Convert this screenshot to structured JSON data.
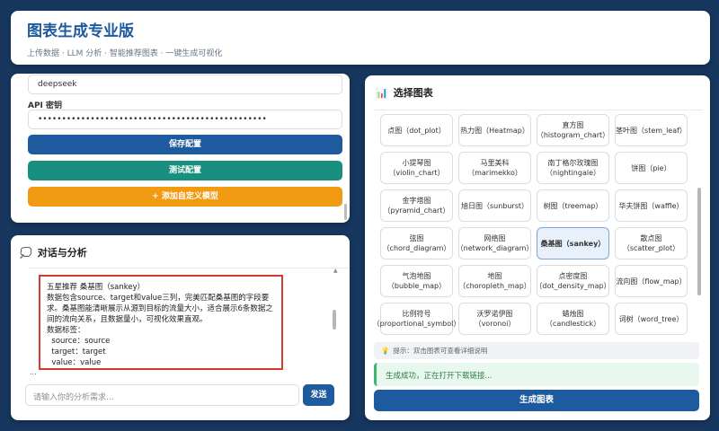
{
  "header": {
    "title": "图表生成专业版",
    "subtitle": "上传数据 · LLM 分析 · 智能推荐图表 · 一键生成可视化"
  },
  "config": {
    "model_value": "deepseek",
    "api_key_label": "API 密钥",
    "api_key_value": "••••••••••••••••••••••••••••••••••••••••••••••••",
    "save_label": "保存配置",
    "test_label": "测试配置",
    "add_model_label": "+ 添加自定义模型"
  },
  "chat": {
    "title": "对话与分析",
    "icon": "speech-bubble-icon",
    "message": {
      "line1": "五星推荐 桑基图（sankey）",
      "paragraph": "数据包含source、target和value三列，完美匹配桑基图的字段要求。桑基图能清晰展示从源到目标的流量大小，适合展示6条数据之间的流向关系，且数据量小，可视化效果直观。",
      "line3": "数据标签：",
      "line4": "  source：source",
      "line5": "  target：target",
      "line6": "  value：value"
    },
    "more": "...",
    "input_placeholder": "请输入你的分析需求...",
    "send_label": "发送"
  },
  "selector": {
    "title": "选择图表",
    "icon": "bar-chart-icon",
    "options": [
      {
        "name": "点图",
        "id": "（dot_plot）",
        "inline": true
      },
      {
        "name": "热力图",
        "id": "（Heatmap）",
        "inline": true
      },
      {
        "name": "直方图",
        "id": "（histogram_chart）",
        "inline": false
      },
      {
        "name": "茎叶图",
        "id": "（stem_leaf）",
        "inline": true
      },
      {
        "name": "小提琴图",
        "id": "（violin_chart）",
        "inline": false
      },
      {
        "name": "马里美科",
        "id": "（marimekko）",
        "inline": false
      },
      {
        "name": "南丁格尔玫瑰图",
        "id": "（nightingale）",
        "inline": false
      },
      {
        "name": "饼图",
        "id": "（pie）",
        "inline": true
      },
      {
        "name": "金字塔图",
        "id": "（pyramid_chart）",
        "inline": false
      },
      {
        "name": "旭日图",
        "id": "（sunburst）",
        "inline": true
      },
      {
        "name": "树图",
        "id": "（treemap）",
        "inline": true
      },
      {
        "name": "华夫饼图",
        "id": "（waffle）",
        "inline": true
      },
      {
        "name": "弦图",
        "id": "（chord_diagram）",
        "inline": false
      },
      {
        "name": "网络图",
        "id": "（network_diagram）",
        "inline": false
      },
      {
        "name": "桑基图",
        "id": "（sankey）",
        "inline": true,
        "selected": true
      },
      {
        "name": "散点图",
        "id": "（scatter_plot）",
        "inline": false
      },
      {
        "name": "气泡地图",
        "id": "（bubble_map）",
        "inline": false
      },
      {
        "name": "地图",
        "id": "（choropleth_map）",
        "inline": false
      },
      {
        "name": "点密度图",
        "id": "（dot_density_map）",
        "inline": false
      },
      {
        "name": "流向图",
        "id": "（flow_map）",
        "inline": true
      },
      {
        "name": "比例符号",
        "id": "（proportional_symbol）",
        "inline": false
      },
      {
        "name": "沃罗诺伊图",
        "id": "（voronoi）",
        "inline": false
      },
      {
        "name": "蜡烛图",
        "id": "（candlestick）",
        "inline": false
      },
      {
        "name": "词树",
        "id": "（word_tree）",
        "inline": true
      }
    ],
    "hint": "提示：双击图表可查看详细说明",
    "status": "生成成功，正在打开下载链接...",
    "generate_label": "生成图表"
  }
}
